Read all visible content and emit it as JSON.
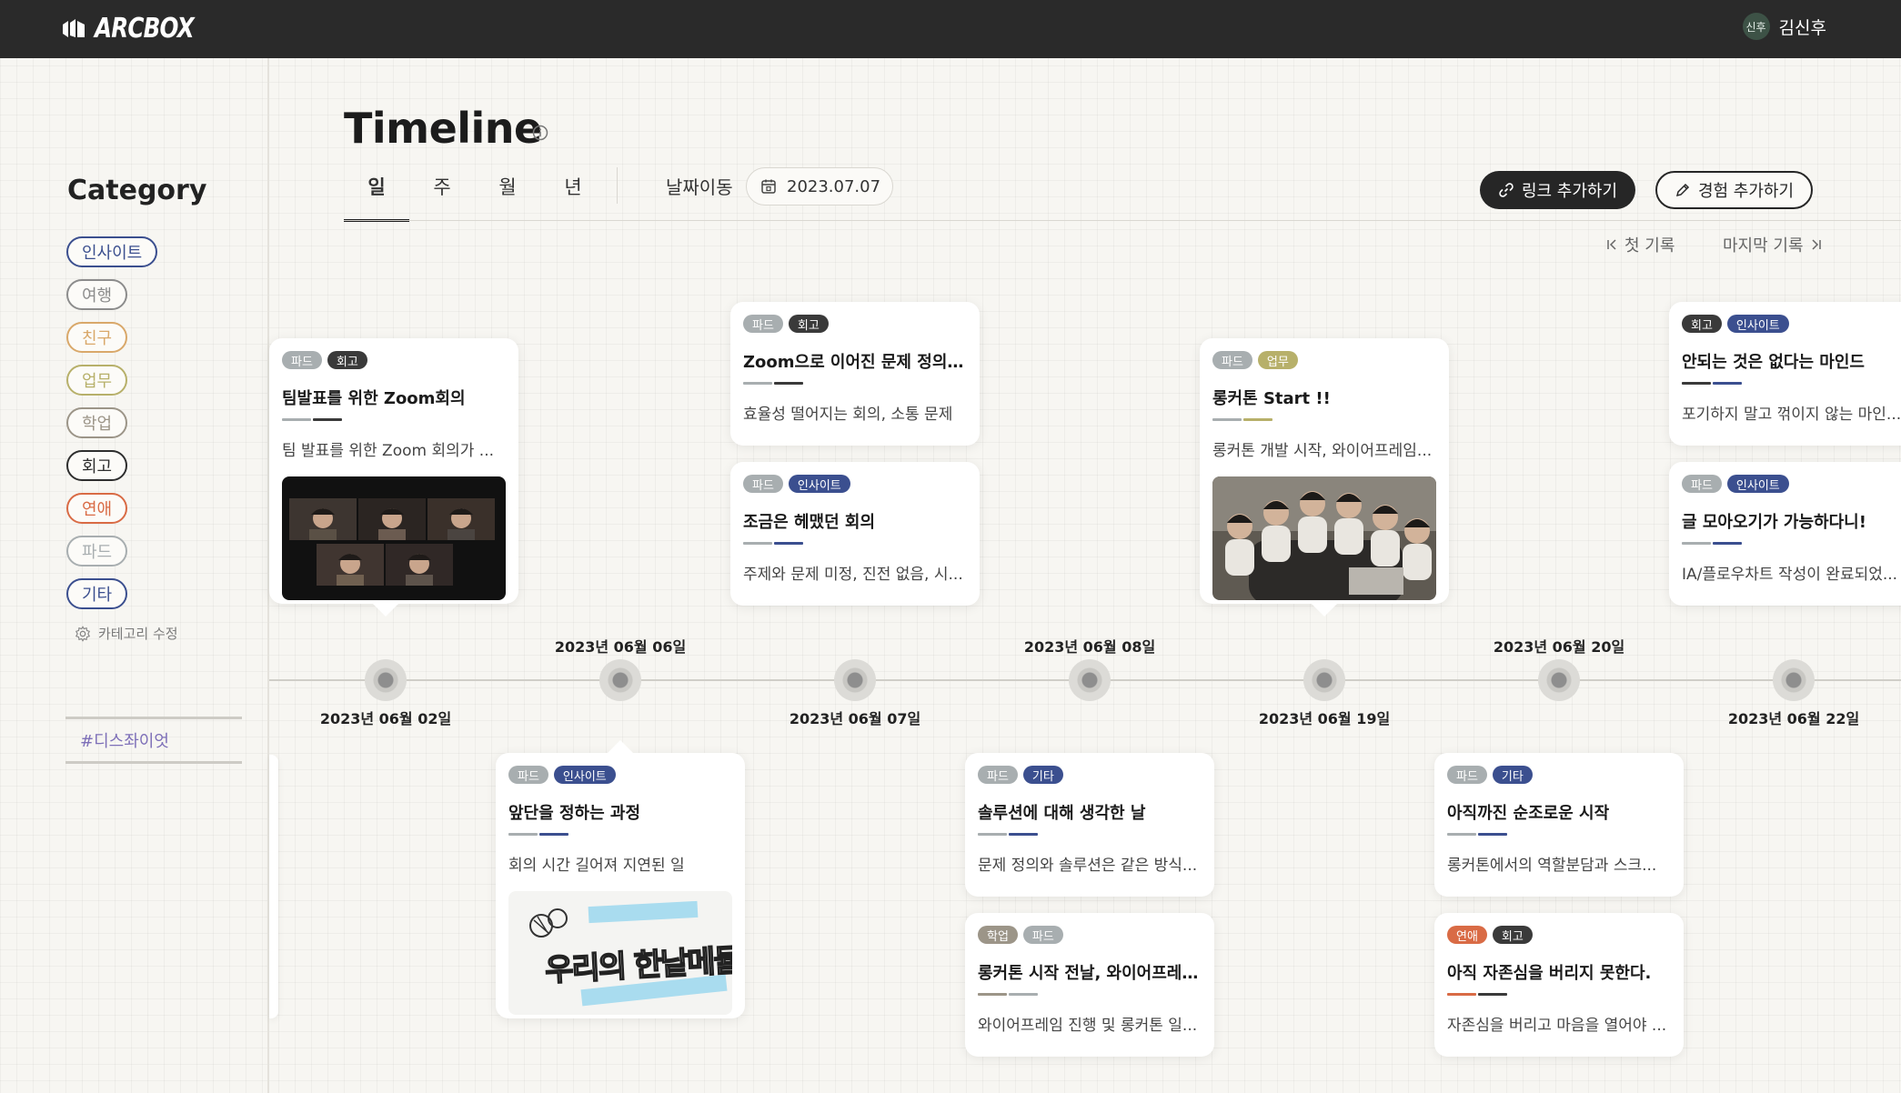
{
  "app": {
    "logo_text": "ARCBOX"
  },
  "user": {
    "avatar_text": "신후",
    "name": "김신후"
  },
  "sidebar": {
    "title": "Category",
    "categories": [
      {
        "label": "인사이트",
        "color": "#3b4f8f"
      },
      {
        "label": "여행",
        "color": "#8c8c8c"
      },
      {
        "label": "친구",
        "color": "#d9a86a"
      },
      {
        "label": "업무",
        "color": "#b7b06a"
      },
      {
        "label": "학업",
        "color": "#9c9588"
      },
      {
        "label": "회고",
        "color": "#2e2e2e"
      },
      {
        "label": "연애",
        "color": "#d96b45"
      },
      {
        "label": "파드",
        "color": "#a8aeb0"
      },
      {
        "label": "기타",
        "color": "#3b4f8f"
      }
    ],
    "edit_label": "카테고리 수정",
    "tag": "#디스좌이엇"
  },
  "header": {
    "title": "Timeline",
    "tabs": [
      "일",
      "주",
      "월",
      "년"
    ],
    "date_move_label": "날짜이동",
    "date_value": "2023.07.07",
    "add_link": "링크 추가하기",
    "add_experience": "경험 추가하기",
    "first_record": "첫 기록",
    "last_record": "마지막 기록"
  },
  "tag_colors": {
    "파드": "#a8aeb0",
    "회고": "#3a3a3a",
    "인사이트": "#3b4f8f",
    "업무": "#b7b06a",
    "기타": "#3b4f8f",
    "학업": "#9c9588",
    "연애": "#d96b45"
  },
  "timeline": {
    "dates_top": [
      "2023년 06월 06일",
      "2023년 06월 08일",
      "2023년 06월 20일"
    ],
    "dates_bottom": [
      "2023년 06월 02일",
      "2023년 06월 07일",
      "2023년 06월 19일",
      "2023년 06월 22일"
    ]
  },
  "cards": [
    {
      "tags": [
        "파드",
        "회고"
      ],
      "title": "팀발표를 위한 Zoom회의",
      "desc": "팀 발표를 위한 Zoom 회의가 ...",
      "image": "zoom"
    },
    {
      "tags": [
        "파드",
        "회고"
      ],
      "title": "Zoom으로 이어진 문제 정의 회의",
      "desc": "효율성 떨어지는 회의, 소통 문제"
    },
    {
      "tags": [
        "파드",
        "인사이트"
      ],
      "title": "조금은 헤맸던 회의",
      "desc": "주제와 문제 미정, 진전 없음, 시..."
    },
    {
      "tags": [
        "파드",
        "업무"
      ],
      "title": "롱커톤 Start !!",
      "desc": "롱커톤 개발 시작, 와이어프레임...",
      "image": "group"
    },
    {
      "tags": [
        "회고",
        "인사이트"
      ],
      "title": "안되는 것은 없다는 마인드",
      "desc": "포기하지 말고 꺾이지 않는 마인..."
    },
    {
      "tags": [
        "파드",
        "인사이트"
      ],
      "title": "글 모아오기가 가능하다니!",
      "desc": "IA/플로우차트 작성이 완료되었..."
    },
    {
      "tags": [
        "파드",
        "인사이트"
      ],
      "title": "앞단을 정하는 과정",
      "desc": "회의 시간 길어져 지연된 일",
      "image": "sketch"
    },
    {
      "tags": [
        "파드",
        "기타"
      ],
      "title": "솔루션에 대해 생각한 날",
      "desc": "문제 정의와 솔루션은 같은 방식..."
    },
    {
      "tags": [
        "학업",
        "파드"
      ],
      "title": "롱커톤 시작 전날, 와이어프레임...",
      "desc": "와이어프레임 진행 및 롱커톤 일..."
    },
    {
      "tags": [
        "파드",
        "기타"
      ],
      "title": "아직까진 순조로운 시작",
      "desc": "롱커톤에서의 역할분담과 스크..."
    },
    {
      "tags": [
        "연애",
        "회고"
      ],
      "title": "아직 자존심을 버리지 못한다.",
      "desc": "자존심을 버리고 마음을 열어야 ..."
    }
  ],
  "sketch_text": "우리의 한낱메듈"
}
